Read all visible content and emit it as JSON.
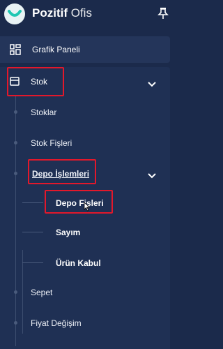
{
  "brand": {
    "name_bold": "Pozitif",
    "name_light": "Ofis",
    "logo_icon": "smile-logo-icon",
    "pin_icon": "pin-icon"
  },
  "menu": {
    "dashboard": {
      "label": "Grafik Paneli",
      "icon": "dashboard-grid-icon"
    },
    "stok": {
      "label": "Stok",
      "icon": "box-icon",
      "expanded": true
    },
    "stok_items": [
      "Stoklar",
      "Stok Fişleri"
    ],
    "depo": {
      "label": "Depo İşlemleri",
      "expanded": true
    },
    "depo_items": [
      "Depo Fişleri",
      "Sayım",
      "Ürün Kabul"
    ],
    "after_items": [
      "Sepet",
      "Fiyat Değişim"
    ]
  },
  "colors": {
    "sidebar_bg": "#1b2a4b",
    "highlight": "#e3182b",
    "logo_bg": "#e9f3f5"
  }
}
